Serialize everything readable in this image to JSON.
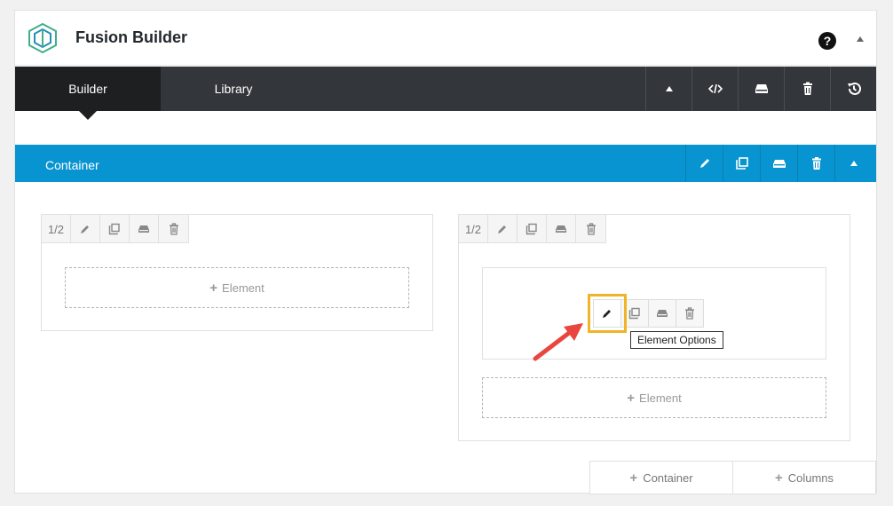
{
  "app": {
    "title": "Fusion Builder",
    "help_glyph": "?"
  },
  "tabs": [
    {
      "label": "Builder",
      "active": true
    },
    {
      "label": "Library",
      "active": false
    }
  ],
  "toolbar_icons": [
    "chevron-up-icon",
    "code-icon",
    "save-icon",
    "trash-icon",
    "history-icon"
  ],
  "container": {
    "title": "Container",
    "icons": [
      "pencil-icon",
      "clone-icon",
      "save-icon",
      "trash-icon",
      "chevron-up-icon"
    ]
  },
  "columns": [
    {
      "size": "1/2",
      "add_element_label": "Element"
    },
    {
      "size": "1/2",
      "add_element_label": "Element"
    }
  ],
  "element_controls": {
    "icons": [
      "pencil-icon",
      "clone-icon",
      "save-icon",
      "trash-icon"
    ],
    "tooltip": "Element Options"
  },
  "bottom_buttons": [
    {
      "label": "Container"
    },
    {
      "label": "Columns"
    }
  ],
  "colors": {
    "accent_blue": "#0894d0",
    "toolbar_dark": "#33363a",
    "highlight": "#f0b429",
    "arrow_red": "#e8463f"
  }
}
